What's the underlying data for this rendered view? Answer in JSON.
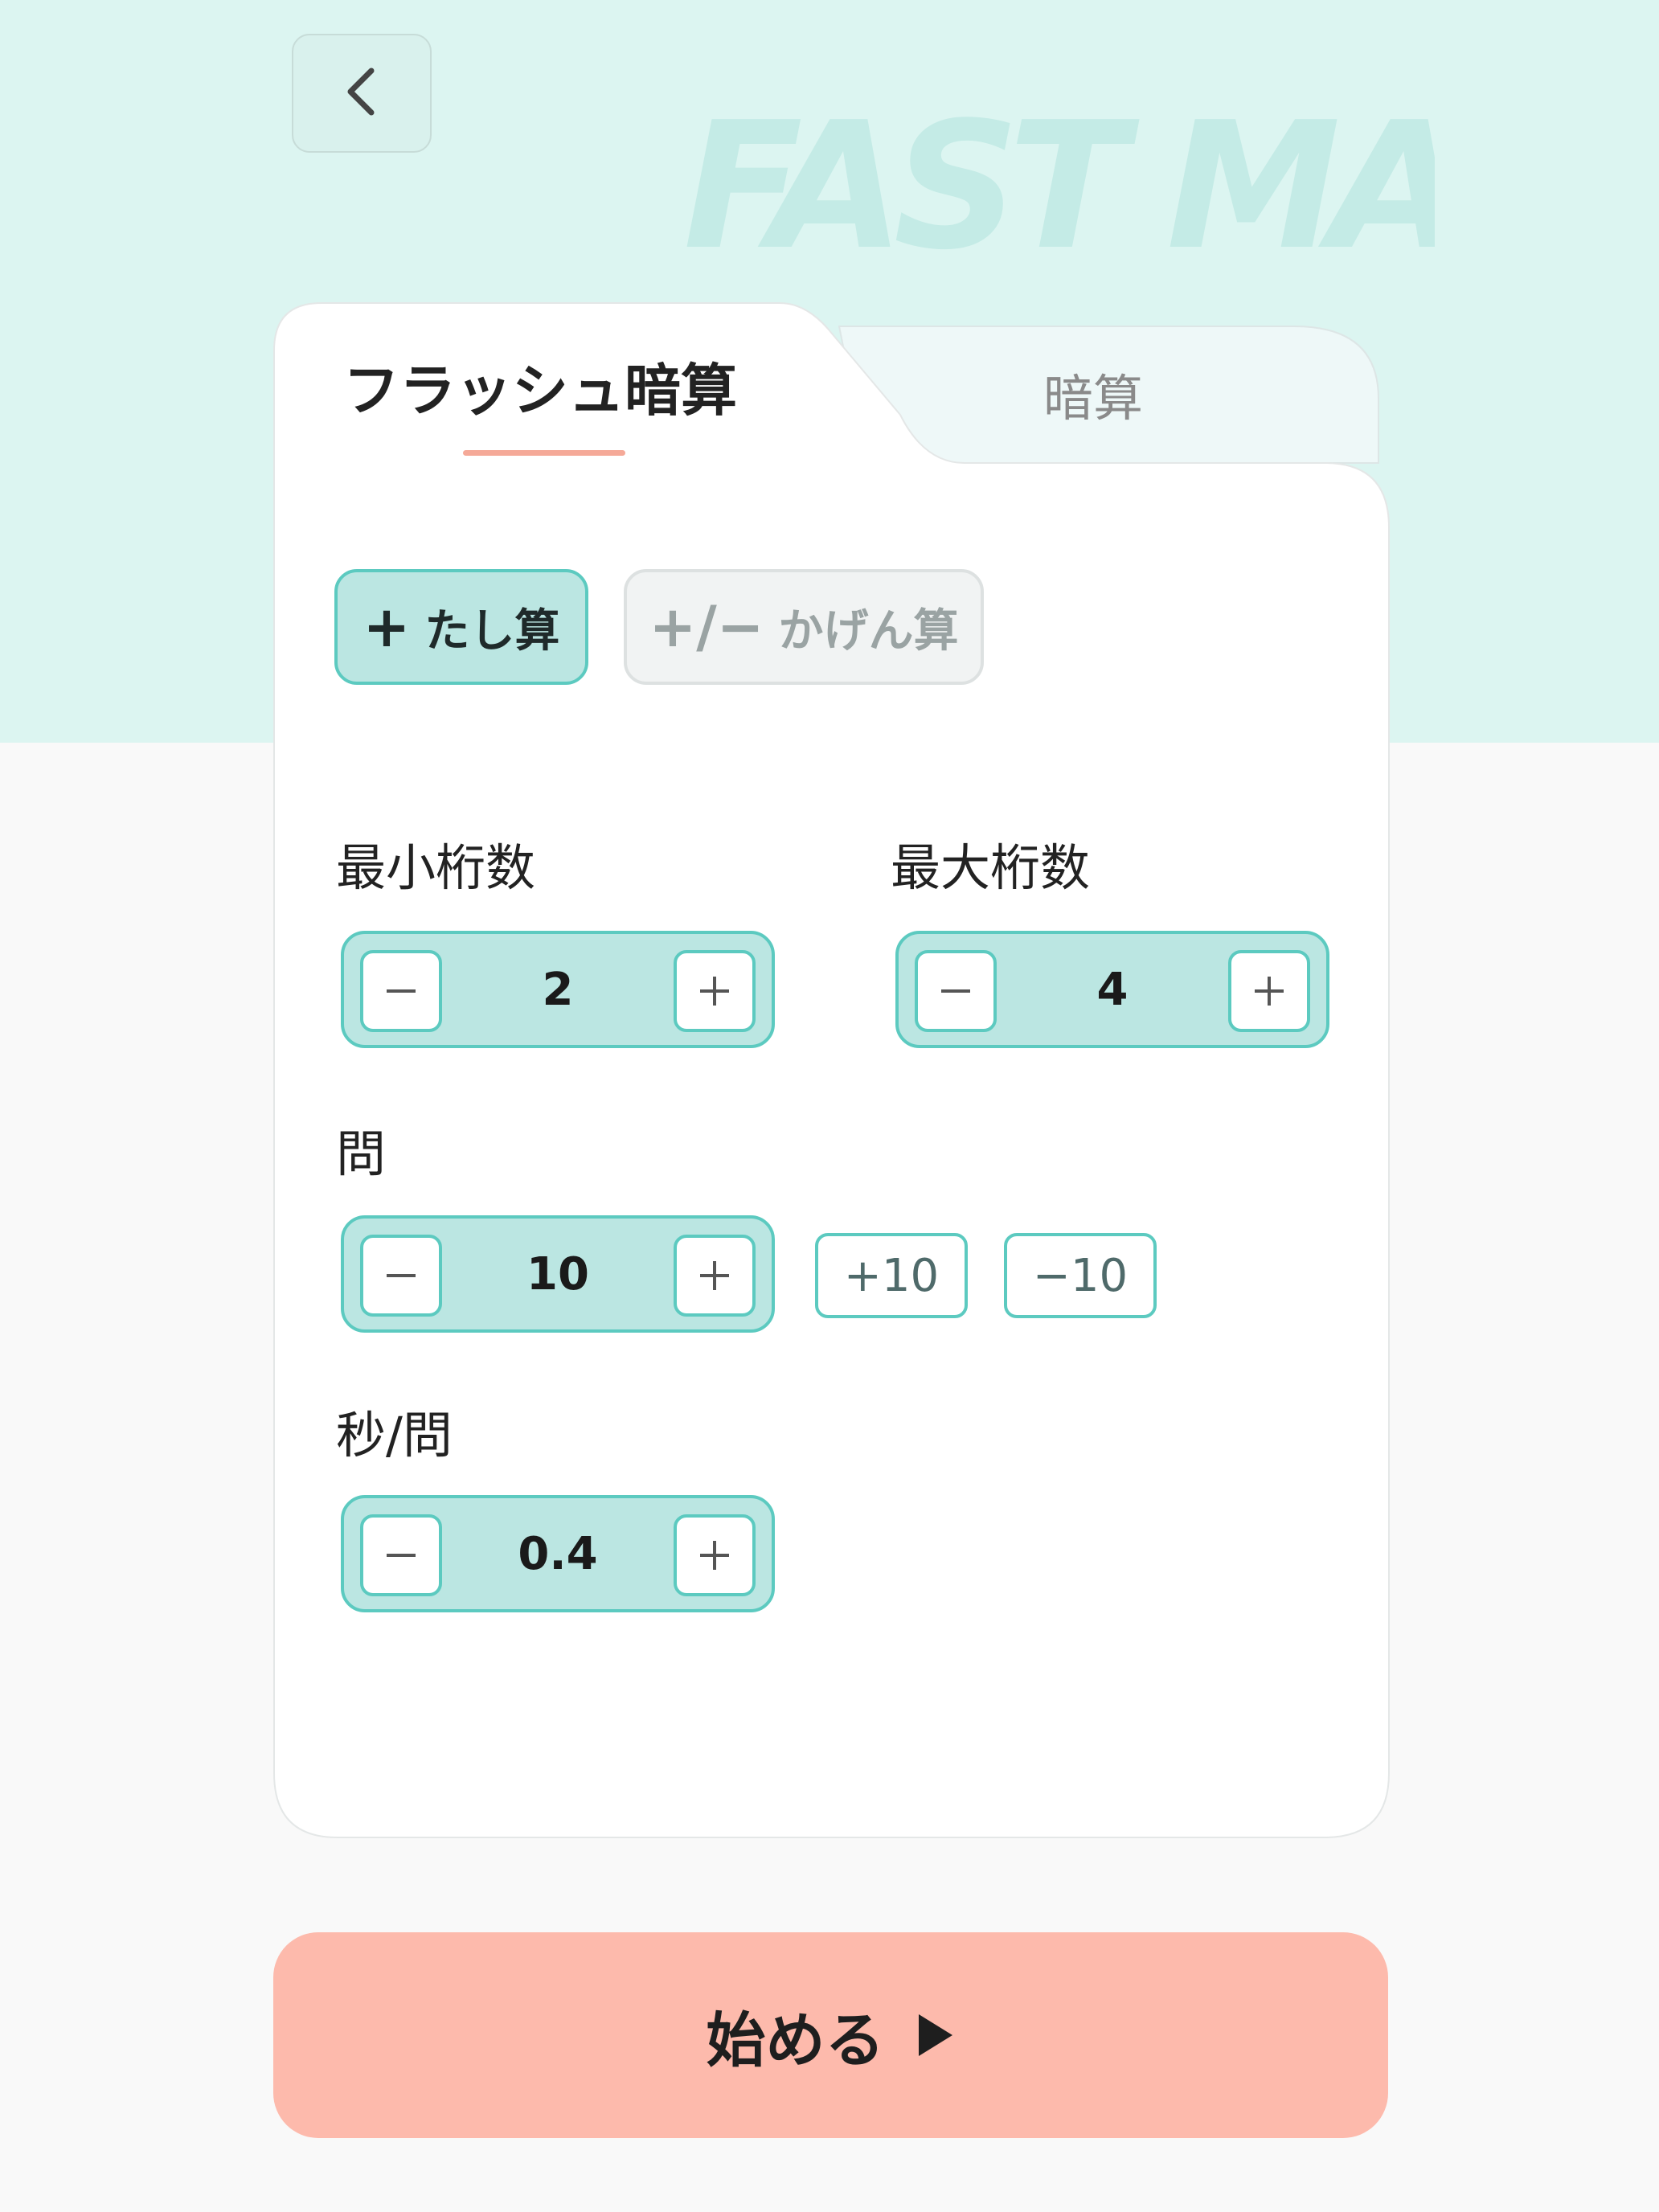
{
  "brand": {
    "watermark": "FAST MATH"
  },
  "header": {
    "back_icon": "chevron-left-icon"
  },
  "tabs": [
    {
      "label": "フラッシュ暗算",
      "active": true
    },
    {
      "label": "暗算",
      "active": false
    }
  ],
  "operations": {
    "add": {
      "icon": "+",
      "label": "たし算",
      "selected": true
    },
    "add_sub": {
      "icon": "+/−",
      "label": "かげん算",
      "selected": false
    }
  },
  "settings": {
    "min_digits": {
      "label": "最小桁数",
      "value": "2"
    },
    "max_digits": {
      "label": "最大桁数",
      "value": "4"
    },
    "questions": {
      "label": "問",
      "value": "10",
      "quick_add": "+10",
      "quick_sub": "−10"
    },
    "seconds_per_question": {
      "label": "秒/問",
      "value": "0.4"
    }
  },
  "start": {
    "label": "始める",
    "icon": "play-icon"
  },
  "colors": {
    "band": "#dcf5f1",
    "accent_teal": "#5ccac0",
    "stepper_fill": "#bbe6e2",
    "underline": "#f5a998",
    "start_button": "#fdbaac"
  }
}
